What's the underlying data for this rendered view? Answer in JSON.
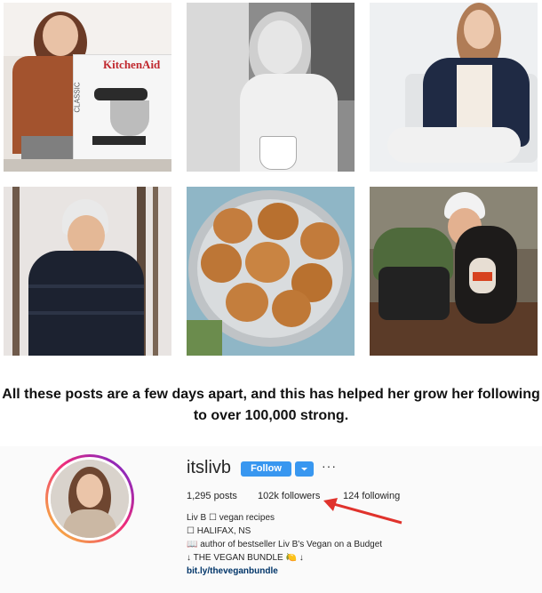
{
  "caption": {
    "line1": "All these posts are a few days apart, and this has helped her grow her following",
    "line2": "to over 100,000 strong."
  },
  "posts": [
    {
      "alt": "kitchenaid-mixer-photo",
      "box_text": "KitchenAid",
      "box_side_text": "CLASSIC"
    },
    {
      "alt": "coffee-window-photo"
    },
    {
      "alt": "sitting-chair-photo"
    },
    {
      "alt": "winter-jacket-photo"
    },
    {
      "alt": "cookies-bowl-photo"
    },
    {
      "alt": "dog-forest-photo"
    }
  ],
  "profile": {
    "username": "itslivb",
    "follow_label": "Follow",
    "more_label": "···",
    "posts": "1,295 posts",
    "followers": "102k followers",
    "following": "124 following",
    "bio_lines": [
      "Liv B ☐ vegan recipes",
      "☐ HALIFAX, NS",
      "📖 author of bestseller Liv B's Vegan on a Budget",
      "↓ THE VEGAN BUNDLE 🍋 ↓"
    ],
    "link": "bit.ly/theveganbundle"
  },
  "colors": {
    "follow": "#3897f0",
    "arrow": "#e0322c",
    "link": "#003569"
  }
}
